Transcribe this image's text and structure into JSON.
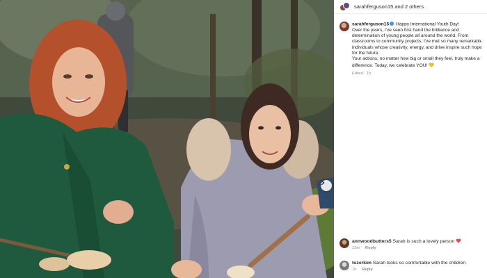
{
  "header": {
    "text": "sarahferguson15 and 2 others"
  },
  "caption": {
    "username": "sarahferguson15",
    "lines": [
      "Happy International Youth Day!",
      "Over the years, I've seen first hand the brilliance and",
      "determination of young people all around the world. From",
      "classrooms to community projects, I've met so many remarkable",
      "individuals whose creativity, energy, and drive inspire such hope",
      "for the future.",
      "Your actions, no matter how big or small they feel, truly make a",
      "difference. Today, we celebrate YOU!"
    ],
    "edited": "Edited",
    "time": "1h"
  },
  "comments": [
    {
      "username": "annwoodbutters5",
      "text": "Sarah is such a lovely person",
      "time": "13m",
      "reply": "Reply"
    },
    {
      "username": "tozerkim",
      "text": "Sarah looks so comfortable with the children",
      "time": "1h",
      "reply": "Reply"
    }
  ],
  "colors": {
    "verified": "#3897f0",
    "heart_red": "#ed4956",
    "heart_yellow": "#f5c518",
    "meta_gray": "#8e8e8e"
  },
  "icons": {
    "next": "chevron-right-icon",
    "verified": "verified-badge-icon",
    "comment_like": "heart-icon",
    "caption_emoji": "yellow-heart-icon"
  }
}
